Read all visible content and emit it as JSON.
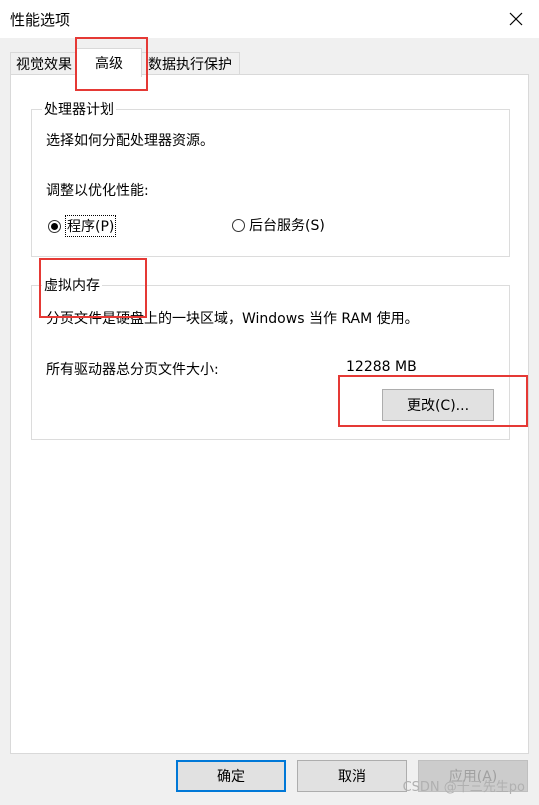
{
  "window": {
    "title": "性能选项",
    "close_icon": "close-icon"
  },
  "tabs": [
    {
      "label": "视觉效果"
    },
    {
      "label": "高级"
    },
    {
      "label": "数据执行保护"
    }
  ],
  "processor": {
    "title": "处理器计划",
    "description": "选择如何分配处理器资源。",
    "adjust_label": "调整以优化性能:",
    "option_programs": "程序(P)",
    "option_services": "后台服务(S)",
    "selected": "程序(P)"
  },
  "virtual_memory": {
    "title": "虚拟内存",
    "description": "分页文件是硬盘上的一块区域，Windows 当作 RAM 使用。",
    "total_label": "所有驱动器总分页文件大小:",
    "total_value": "12288 MB",
    "change_button": "更改(C)..."
  },
  "footer": {
    "ok": "确定",
    "cancel": "取消",
    "apply": "应用(A)"
  },
  "watermark": "CSDN @十三先生po",
  "colors": {
    "highlight_box": "#e53935",
    "default_button_border": "#0078d7"
  }
}
